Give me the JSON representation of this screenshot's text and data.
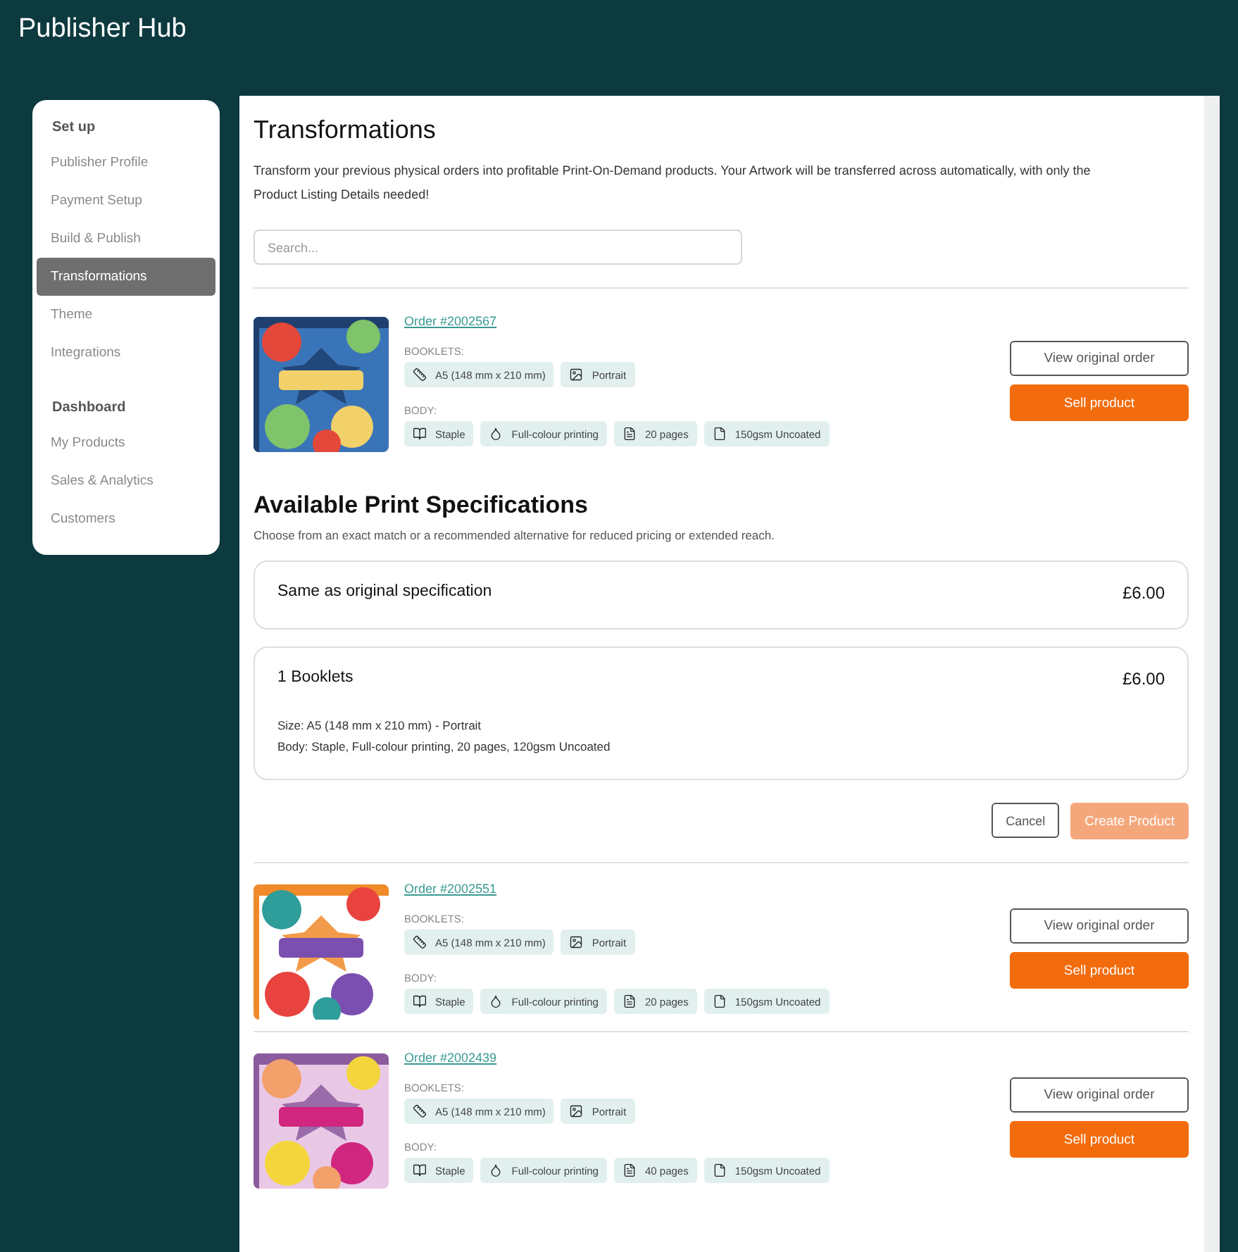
{
  "app": {
    "title": "Publisher Hub"
  },
  "sidebar": {
    "sections": [
      {
        "heading": "Set up",
        "items": [
          {
            "label": "Publisher Profile",
            "selected": false
          },
          {
            "label": "Payment Setup",
            "selected": false
          },
          {
            "label": "Build & Publish",
            "selected": false
          },
          {
            "label": "Transformations",
            "selected": true
          },
          {
            "label": "Theme",
            "selected": false
          },
          {
            "label": "Integrations",
            "selected": false
          }
        ]
      },
      {
        "heading": "Dashboard",
        "items": [
          {
            "label": "My Products",
            "selected": false
          },
          {
            "label": "Sales & Analytics",
            "selected": false
          },
          {
            "label": "Customers",
            "selected": false
          }
        ]
      }
    ]
  },
  "page": {
    "title": "Transformations",
    "intro": "Transform your previous physical orders into profitable Print-On-Demand products. Your Artwork will be transferred across automatically, with only the Product Listing Details needed!",
    "search": {
      "placeholder": "Search..."
    }
  },
  "open_order": {
    "order": "Order #2002567",
    "booklets_label": "BOOKLETS:",
    "booklets": [
      {
        "kind": "size",
        "text": "A5 (148 mm x 210 mm)"
      },
      {
        "kind": "orientation",
        "text": "Portrait"
      }
    ],
    "body_label": "BODY:",
    "body": [
      {
        "kind": "binding",
        "text": "Staple"
      },
      {
        "kind": "printing",
        "text": "Full-colour printing"
      },
      {
        "kind": "pages",
        "text": "20 pages"
      },
      {
        "kind": "paper",
        "text": "150gsm Uncoated"
      }
    ],
    "view_button": "View original order",
    "sell_button": "Sell product"
  },
  "specifications": {
    "title": "Available Print Specifications",
    "subtitle": "Choose from an exact match or a recommended alternative for reduced pricing or extended reach.",
    "options": [
      {
        "name": "Same as original specification",
        "price": "£6.00"
      },
      {
        "name": "1 Booklets",
        "price": "£6.00",
        "details": [
          "Size: A5 (148 mm x 210 mm) - Portrait",
          "Body: Staple, Full-colour printing, 20 pages, 120gsm Uncoated"
        ]
      }
    ],
    "cancel_button": "Cancel",
    "create_button": {
      "label": "Create Product",
      "disabled": true
    }
  },
  "other_orders": [
    {
      "order": "Order #2002551",
      "booklets_label": "BOOKLETS:",
      "booklets": [
        {
          "kind": "size",
          "text": "A5 (148 mm x 210 mm)"
        },
        {
          "kind": "orientation",
          "text": "Portrait"
        }
      ],
      "body_label": "BODY:",
      "body": [
        {
          "kind": "binding",
          "text": "Staple"
        },
        {
          "kind": "printing",
          "text": "Full-colour printing"
        },
        {
          "kind": "pages",
          "text": "20 pages"
        },
        {
          "kind": "paper",
          "text": "150gsm Uncoated"
        }
      ],
      "view_button": "View original order",
      "sell_button": "Sell product"
    },
    {
      "order": "Order #2002439",
      "booklets_label": "BOOKLETS:",
      "booklets": [
        {
          "kind": "size",
          "text": "A5 (148 mm x 210 mm)"
        },
        {
          "kind": "orientation",
          "text": "Portrait"
        }
      ],
      "body_label": "BODY:",
      "body": [
        {
          "kind": "binding",
          "text": "Staple"
        },
        {
          "kind": "printing",
          "text": "Full-colour printing"
        },
        {
          "kind": "pages",
          "text": "40 pages"
        },
        {
          "kind": "paper",
          "text": "150gsm Uncoated"
        }
      ],
      "view_button": "View original order",
      "sell_button": "Sell product"
    }
  ]
}
